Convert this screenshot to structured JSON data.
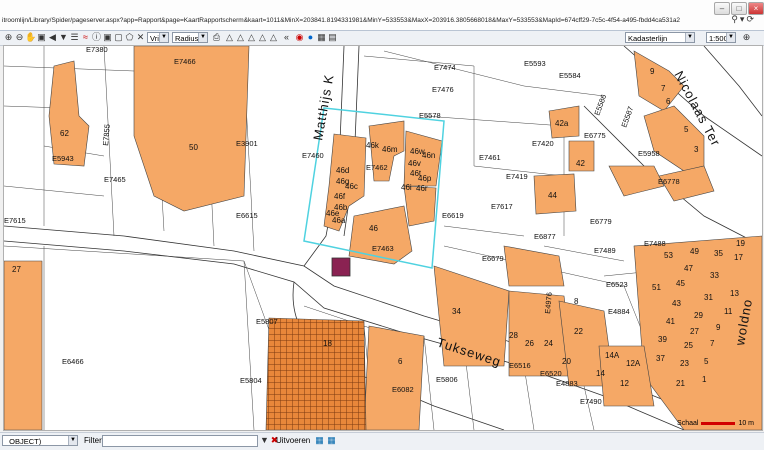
{
  "browser": {
    "url": "itroomlijn/Library/Spider/pageserver.aspx?app=Rapport&page=KaartRapportscherm&kaart=1011&MinX=203841.8194331981&MinY=533553&MaxX=203916.3805668018&MaxY=533553&MapId=674cff29-7c5c-4f54-a495-fbdd4ca531a2",
    "search_icon": "magnifier-icon",
    "refresh_icon": "refresh-icon"
  },
  "toolbar": {
    "select_mode": "Vrij",
    "radius_label": "Radius:",
    "layer_select": "Kadasterlijn",
    "scale_select": "1:500"
  },
  "map": {
    "street_matthijs": "Matthijs K",
    "street_tukseweg": "Tukseweg",
    "street_nicolaas": "Nicolaas Ter",
    "street_woldno": "woldno",
    "parcel_labels": [
      "E7380",
      "E7466",
      "E7474",
      "E5593",
      "E5584",
      "E5578",
      "E7476",
      "E3901",
      "E7460",
      "E7462",
      "E7461",
      "E7420",
      "E7419",
      "E5943",
      "E7855",
      "E7465",
      "E6615",
      "E7615",
      "E6619",
      "E7617",
      "E6877",
      "E6779",
      "E5586",
      "E5587",
      "E6775",
      "E5958",
      "E6778",
      "E7488",
      "E7489",
      "E6679",
      "E6523",
      "E7463",
      "E5807",
      "E6466",
      "E5804",
      "E6082",
      "E5806",
      "E6516",
      "E6520",
      "E4883",
      "E7490",
      "E4884",
      "E4976"
    ],
    "house_numbers": [
      "62",
      "50",
      "27",
      "46k",
      "46m",
      "46w",
      "46n",
      "46d",
      "46g",
      "46c",
      "46f",
      "46b",
      "46e",
      "46a",
      "46i",
      "46v",
      "46p",
      "46t",
      "46r",
      "46",
      "42",
      "42a",
      "44",
      "9",
      "7",
      "6",
      "5",
      "3",
      "49",
      "35",
      "19",
      "53",
      "47",
      "33",
      "17",
      "51",
      "45",
      "31",
      "13",
      "43",
      "29",
      "11",
      "41",
      "27",
      "9",
      "39",
      "25",
      "7",
      "37",
      "23",
      "5",
      "21",
      "1",
      "34",
      "28",
      "26",
      "24",
      "22",
      "20",
      "14A",
      "12A",
      "14",
      "12",
      "18",
      "6",
      "8"
    ],
    "scale_label": "Schaal",
    "scale_value": "10 m",
    "colors": {
      "parcel": "#f5a866",
      "selected_outline": "#4fd2e0",
      "marker": "#8a2252"
    }
  },
  "bottombar": {
    "object_select": "_OBJECT)",
    "filter_label": "Filter",
    "filter_value": "",
    "execute_label": "Uitvoeren"
  }
}
